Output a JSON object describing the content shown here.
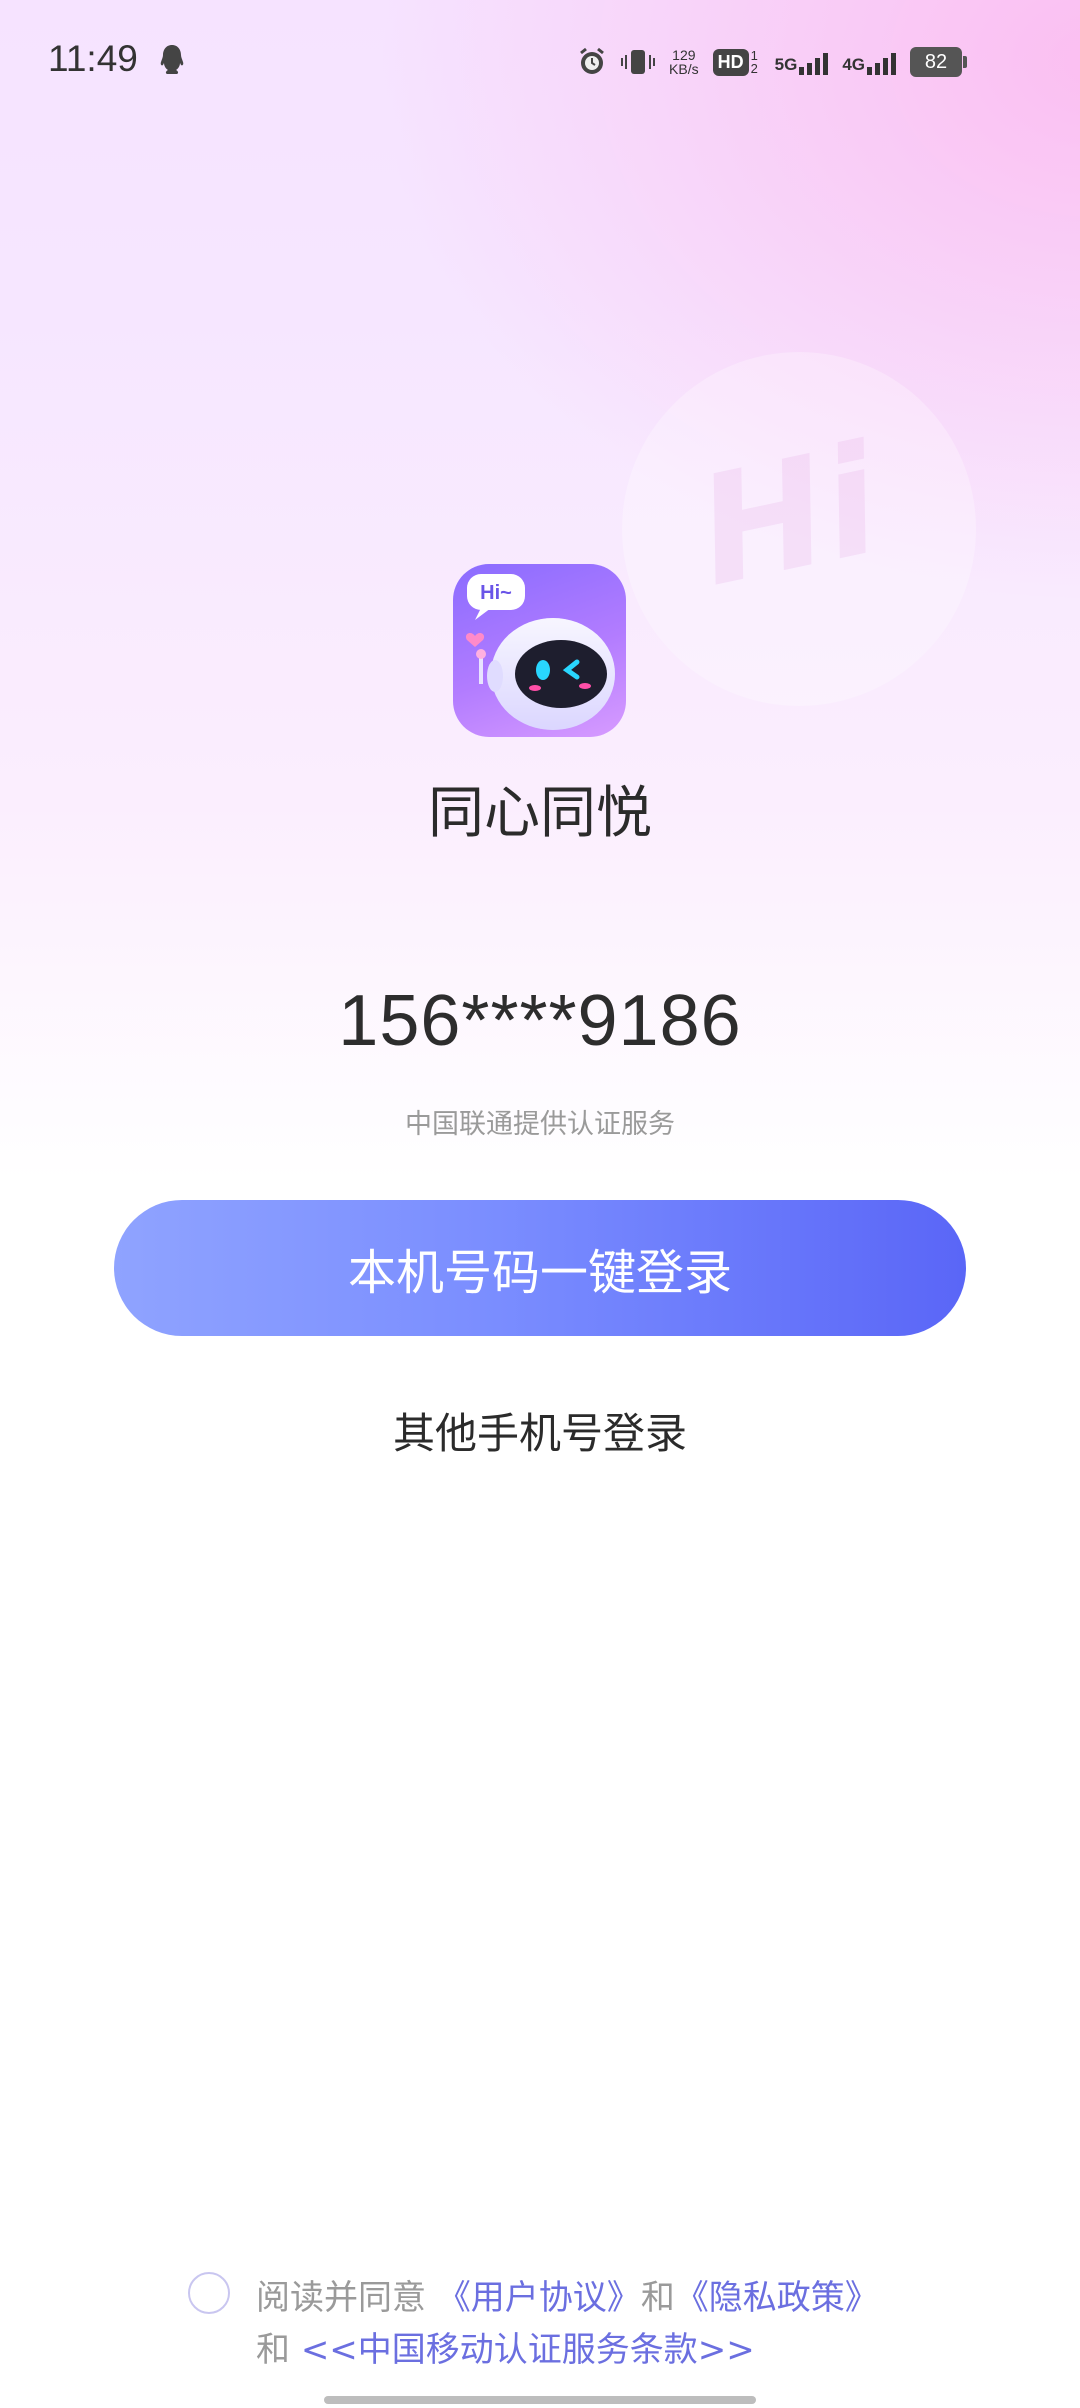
{
  "status_bar": {
    "time": "11:49",
    "net_speed_value": "129",
    "net_speed_unit": "KB/s",
    "hd_label": "HD",
    "hd_sub": "1 2",
    "sig1_label": "5G",
    "sig2_label": "4G",
    "battery": "82",
    "icons": [
      "qq-icon",
      "alarm-icon",
      "vibrate-icon",
      "signal-icon",
      "battery-icon"
    ]
  },
  "app": {
    "name": "同心同悦",
    "logo_bubble_text": "Hi~",
    "bg_watermark": "Hi"
  },
  "login": {
    "phone_number": "156****9186",
    "carrier_note": "中国联通提供认证服务",
    "one_click_label": "本机号码一键登录",
    "other_label": "其他手机号登录"
  },
  "agreement": {
    "prefix": "阅读并同意",
    "user_agreement": "《用户协议》",
    "and1": "和",
    "privacy_policy": "《隐私政策》",
    "and2": "和",
    "carrier_terms": "<<中国移动认证服务条款>>"
  },
  "colors": {
    "button_start": "#8fa3ff",
    "button_end": "#5a66f7",
    "link": "#6b6fe0"
  }
}
